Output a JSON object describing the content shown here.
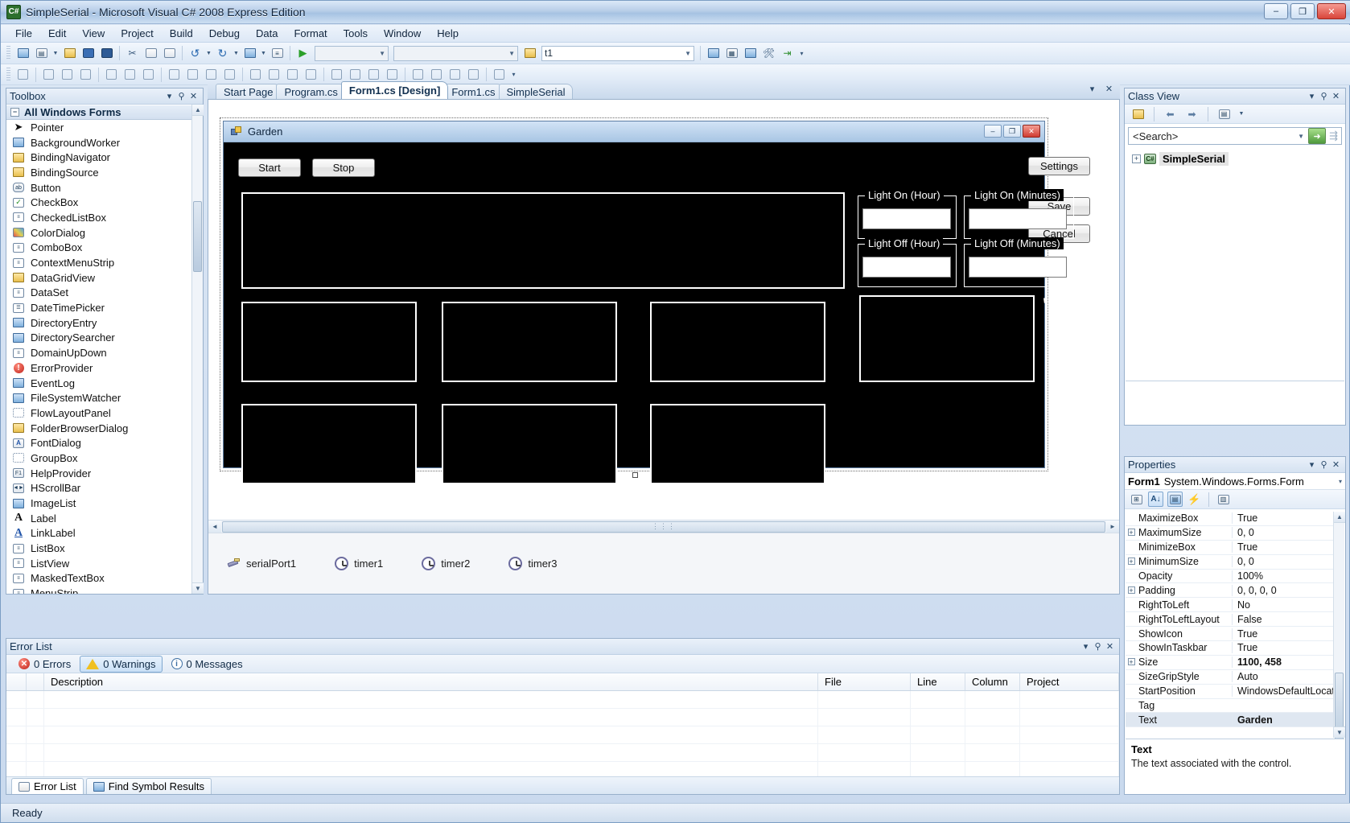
{
  "window": {
    "title": "SimpleSerial - Microsoft Visual C# 2008 Express Edition",
    "icon": "csharp-icon",
    "minimize": "–",
    "maximize": "❐",
    "close": "✕"
  },
  "menu": [
    "File",
    "Edit",
    "View",
    "Project",
    "Build",
    "Debug",
    "Data",
    "Format",
    "Tools",
    "Window",
    "Help"
  ],
  "toolbar": {
    "standard": [
      "new-project-icon",
      "add-new-item-icon",
      "open-file-icon",
      "save-icon",
      "save-all-icon",
      "cut-icon",
      "copy-icon",
      "paste-icon",
      "undo-icon",
      "redo-icon",
      "navigate-back-icon",
      "navigate-forward-icon",
      "start-debug-icon"
    ],
    "solution_config": "",
    "solution_platform": "",
    "find_label": "t1",
    "right_icons": [
      "solution-explorer-icon",
      "properties-window-icon",
      "object-browser-icon",
      "toolbox-icon",
      "start-icon"
    ]
  },
  "toolbox": {
    "title": "Toolbox",
    "group": "All Windows Forms",
    "items": [
      {
        "label": "Pointer",
        "icon": "pointer-icon",
        "selected": false
      },
      {
        "label": "BackgroundWorker",
        "icon": "backgroundworker-icon",
        "selected": false
      },
      {
        "label": "BindingNavigator",
        "icon": "bindingnavigator-icon",
        "selected": false
      },
      {
        "label": "BindingSource",
        "icon": "bindingsource-icon",
        "selected": false
      },
      {
        "label": "Button",
        "icon": "button-icon",
        "selected": false
      },
      {
        "label": "CheckBox",
        "icon": "checkbox-icon",
        "selected": false
      },
      {
        "label": "CheckedListBox",
        "icon": "checkedlistbox-icon",
        "selected": false
      },
      {
        "label": "ColorDialog",
        "icon": "colordialog-icon",
        "selected": false
      },
      {
        "label": "ComboBox",
        "icon": "combobox-icon",
        "selected": false
      },
      {
        "label": "ContextMenuStrip",
        "icon": "contextmenustrip-icon",
        "selected": false
      },
      {
        "label": "DataGridView",
        "icon": "datagridview-icon",
        "selected": false
      },
      {
        "label": "DataSet",
        "icon": "dataset-icon",
        "selected": false
      },
      {
        "label": "DateTimePicker",
        "icon": "datetimepicker-icon",
        "selected": false
      },
      {
        "label": "DirectoryEntry",
        "icon": "directoryentry-icon",
        "selected": false
      },
      {
        "label": "DirectorySearcher",
        "icon": "directorysearcher-icon",
        "selected": false
      },
      {
        "label": "DomainUpDown",
        "icon": "domainupdown-icon",
        "selected": false
      },
      {
        "label": "ErrorProvider",
        "icon": "errorprovider-icon",
        "selected": false
      },
      {
        "label": "EventLog",
        "icon": "eventlog-icon",
        "selected": false
      },
      {
        "label": "FileSystemWatcher",
        "icon": "filesystemwatcher-icon",
        "selected": false
      },
      {
        "label": "FlowLayoutPanel",
        "icon": "flowlayoutpanel-icon",
        "selected": false
      },
      {
        "label": "FolderBrowserDialog",
        "icon": "folderbrowserdialog-icon",
        "selected": false
      },
      {
        "label": "FontDialog",
        "icon": "fontdialog-icon",
        "selected": false
      },
      {
        "label": "GroupBox",
        "icon": "groupbox-icon",
        "selected": false
      },
      {
        "label": "HelpProvider",
        "icon": "helpprovider-icon",
        "selected": false
      },
      {
        "label": "HScrollBar",
        "icon": "hscrollbar-icon",
        "selected": false
      },
      {
        "label": "ImageList",
        "icon": "imagelist-icon",
        "selected": false
      },
      {
        "label": "Label",
        "icon": "label-icon",
        "selected": false
      },
      {
        "label": "LinkLabel",
        "icon": "linklabel-icon",
        "selected": false
      },
      {
        "label": "ListBox",
        "icon": "listbox-icon",
        "selected": false
      },
      {
        "label": "ListView",
        "icon": "listview-icon",
        "selected": false
      },
      {
        "label": "MaskedTextBox",
        "icon": "maskedtextbox-icon",
        "selected": false
      },
      {
        "label": "MenuStrip",
        "icon": "menustrip-icon",
        "selected": false
      }
    ]
  },
  "document": {
    "tabs": [
      {
        "label": "Start Page",
        "active": false
      },
      {
        "label": "Program.cs",
        "active": false
      },
      {
        "label": "Form1.cs [Design]",
        "active": true
      },
      {
        "label": "Form1.cs",
        "active": false
      },
      {
        "label": "SimpleSerial",
        "active": false
      }
    ]
  },
  "form": {
    "title": "Garden",
    "min_btn": "–",
    "max_btn": "❐",
    "close_btn": "✕",
    "buttons": [
      {
        "name": "start-button",
        "label": "Start"
      },
      {
        "name": "stop-button",
        "label": "Stop"
      },
      {
        "name": "settings-button",
        "label": "Settings"
      },
      {
        "name": "save-button",
        "label": "Save"
      },
      {
        "name": "cancel-button",
        "label": "Cancel"
      }
    ],
    "groupboxes": [
      {
        "name": "light-on-hour-group",
        "label": "Light On (Hour)"
      },
      {
        "name": "light-on-minutes-group",
        "label": "Light On (Minutes)"
      },
      {
        "name": "light-off-hour-group",
        "label": "Light Off (Hour)"
      },
      {
        "name": "light-off-minutes-group",
        "label": "Light Off (Minutes)"
      }
    ],
    "textboxes": [
      {
        "name": "light-on-hour-input",
        "value": ""
      },
      {
        "name": "light-on-minutes-input",
        "value": ""
      },
      {
        "name": "light-off-hour-input",
        "value": ""
      },
      {
        "name": "light-off-minutes-input",
        "value": ""
      }
    ],
    "stray_glyphs": [
      "'",
      "C"
    ]
  },
  "component_tray": [
    {
      "label": "serialPort1",
      "icon": "serial-port-icon"
    },
    {
      "label": "timer1",
      "icon": "timer-icon"
    },
    {
      "label": "timer2",
      "icon": "timer-icon"
    },
    {
      "label": "timer3",
      "icon": "timer-icon"
    }
  ],
  "error_list": {
    "title": "Error List",
    "tabs": [
      {
        "label": "0 Errors",
        "icon": "error-icon",
        "selected": false
      },
      {
        "label": "0 Warnings",
        "icon": "warning-icon",
        "selected": true
      },
      {
        "label": "0 Messages",
        "icon": "info-icon",
        "selected": false
      }
    ],
    "columns": [
      "",
      "",
      "Description",
      "File",
      "Line",
      "Column",
      "Project"
    ],
    "rows": [],
    "bottom_tabs": [
      {
        "label": "Error List",
        "icon": "error-list-icon",
        "active": true
      },
      {
        "label": "Find Symbol Results",
        "icon": "find-symbol-icon",
        "active": false
      }
    ]
  },
  "class_view": {
    "title": "Class View",
    "toolbar_icons": [
      "new-folder-icon",
      "back-icon",
      "forward-icon",
      "view-settings-icon",
      "dropdown-icon"
    ],
    "search_placeholder": "<Search>",
    "go_icon": "go-arrow-icon",
    "clear_icon": "clear-search-icon",
    "nodes": [
      {
        "label": "SimpleSerial",
        "icon": "project-icon",
        "expander": "+",
        "selected": true
      }
    ]
  },
  "properties": {
    "title": "Properties",
    "object": {
      "name": "Form1",
      "type": "System.Windows.Forms.Form"
    },
    "toolbar_icons": [
      "categorized-icon",
      "alphabetical-icon",
      "properties-icon",
      "events-icon",
      "property-pages-icon"
    ],
    "rows": [
      {
        "expander": "",
        "name": "MaximizeBox",
        "value": "True",
        "bold": false,
        "selected": false
      },
      {
        "expander": "+",
        "name": "MaximumSize",
        "value": "0, 0",
        "bold": false,
        "selected": false
      },
      {
        "expander": "",
        "name": "MinimizeBox",
        "value": "True",
        "bold": false,
        "selected": false
      },
      {
        "expander": "+",
        "name": "MinimumSize",
        "value": "0, 0",
        "bold": false,
        "selected": false
      },
      {
        "expander": "",
        "name": "Opacity",
        "value": "100%",
        "bold": false,
        "selected": false
      },
      {
        "expander": "+",
        "name": "Padding",
        "value": "0, 0, 0, 0",
        "bold": false,
        "selected": false
      },
      {
        "expander": "",
        "name": "RightToLeft",
        "value": "No",
        "bold": false,
        "selected": false
      },
      {
        "expander": "",
        "name": "RightToLeftLayout",
        "value": "False",
        "bold": false,
        "selected": false
      },
      {
        "expander": "",
        "name": "ShowIcon",
        "value": "True",
        "bold": false,
        "selected": false
      },
      {
        "expander": "",
        "name": "ShowInTaskbar",
        "value": "True",
        "bold": false,
        "selected": false
      },
      {
        "expander": "+",
        "name": "Size",
        "value": "1100, 458",
        "bold": true,
        "selected": false
      },
      {
        "expander": "",
        "name": "SizeGripStyle",
        "value": "Auto",
        "bold": false,
        "selected": false
      },
      {
        "expander": "",
        "name": "StartPosition",
        "value": "WindowsDefaultLocation",
        "bold": false,
        "selected": false
      },
      {
        "expander": "",
        "name": "Tag",
        "value": "",
        "bold": false,
        "selected": false
      },
      {
        "expander": "",
        "name": "Text",
        "value": "Garden",
        "bold": true,
        "selected": true
      }
    ],
    "description": {
      "title": "Text",
      "text": "The text associated with the control."
    }
  },
  "status": {
    "text": "Ready"
  }
}
